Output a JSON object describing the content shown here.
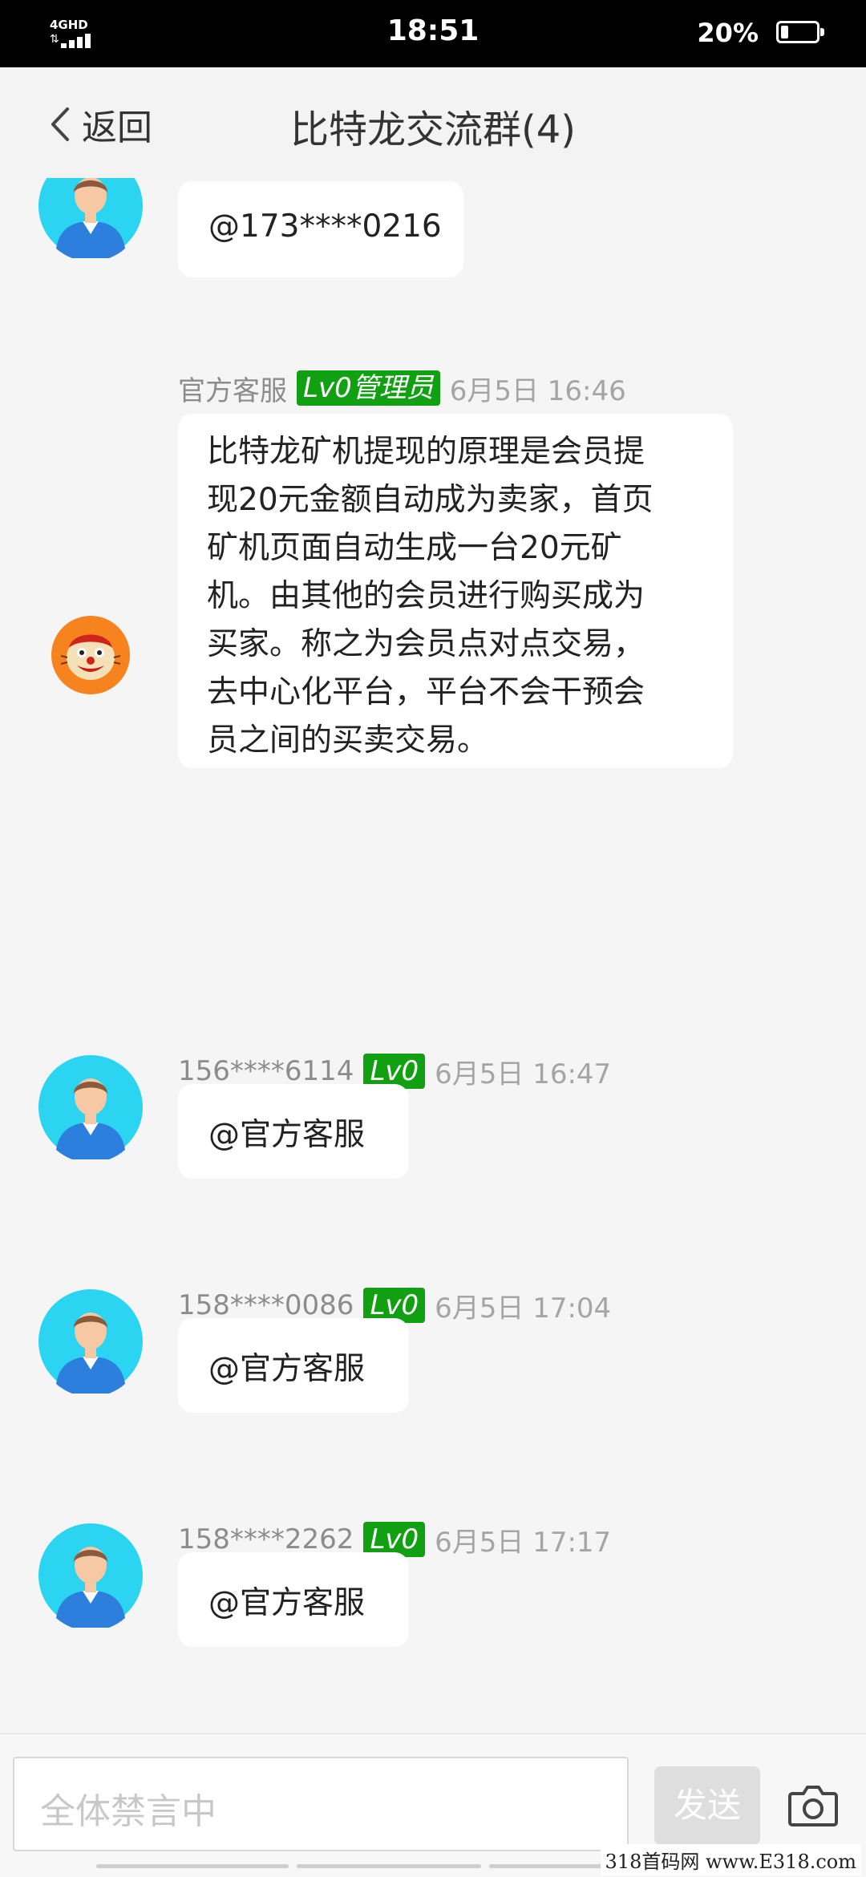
{
  "status_bar": {
    "network": "4GHD",
    "time": "18:51",
    "battery": "20%",
    "battery_level": 0.2
  },
  "nav": {
    "back_label": "返回",
    "title": "比特龙交流群(4)"
  },
  "messages": [
    {
      "sender": "",
      "badge": "",
      "time": "",
      "text": "@173****0216",
      "avatar": "male-avatar-icon"
    },
    {
      "sender": "官方客服",
      "badge": "Lv0管理员",
      "time": "6月5日 16:46",
      "lines": [
        "比特龙矿机提现的原理是会员提",
        "现20元金额自动成为卖家，首页",
        "矿机页面自动生成一台20元矿",
        "机。由其他的会员进行购买成为",
        "买家。称之为会员点对点交易，",
        "去中心化平台，平台不会干预会",
        "员之间的买卖交易。"
      ],
      "avatar": "lion-avatar-icon"
    },
    {
      "sender": "156****6114",
      "badge": "Lv0",
      "time": "6月5日 16:47",
      "text": "@官方客服",
      "avatar": "male-avatar-icon"
    },
    {
      "sender": "158****0086",
      "badge": "Lv0",
      "time": "6月5日 17:04",
      "text": "@官方客服",
      "avatar": "male-avatar-icon"
    },
    {
      "sender": "158****2262",
      "badge": "Lv0",
      "time": "6月5日 17:17",
      "text": "@官方客服",
      "avatar": "male-avatar-icon"
    }
  ],
  "input_bar": {
    "placeholder": "全体禁言中",
    "send_label": "发送"
  },
  "watermark": "318首码网 www.E318.com",
  "colors": {
    "badge": "#12a013",
    "avatar_bg": "#2bd4f0",
    "lion_bg": "#f7831f"
  }
}
